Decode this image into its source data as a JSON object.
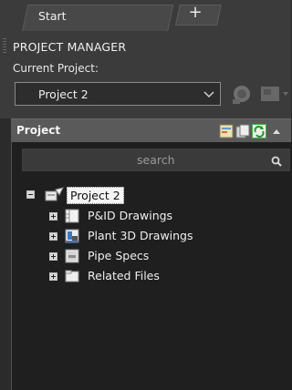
{
  "tabs": [
    {
      "label": "Start",
      "active": true
    },
    {
      "label": "+",
      "active": false
    }
  ],
  "project_manager": {
    "title": "PROJECT MANAGER",
    "current_project_label": "Current Project:",
    "current_project_value": "Project 2"
  },
  "project_panel": {
    "title": "Project",
    "search_placeholder": "search"
  },
  "tree": {
    "root": {
      "label": "Project 2",
      "expanded": true
    },
    "children": [
      {
        "label": "P&ID Drawings",
        "icon": "pid-drawings-icon"
      },
      {
        "label": "Plant 3D Drawings",
        "icon": "plant3d-drawings-icon"
      },
      {
        "label": "Pipe Specs",
        "icon": "pipe-specs-icon"
      },
      {
        "label": "Related Files",
        "icon": "folder-icon"
      }
    ]
  },
  "colors": {
    "panel_bg": "#3b3b3b",
    "tree_bg": "#1f1f1f",
    "header_bg": "#5a5a5a",
    "selected_bg": "#f4f4f4",
    "icon_green": "#3fae49",
    "icon_blue": "#3a78c8"
  }
}
